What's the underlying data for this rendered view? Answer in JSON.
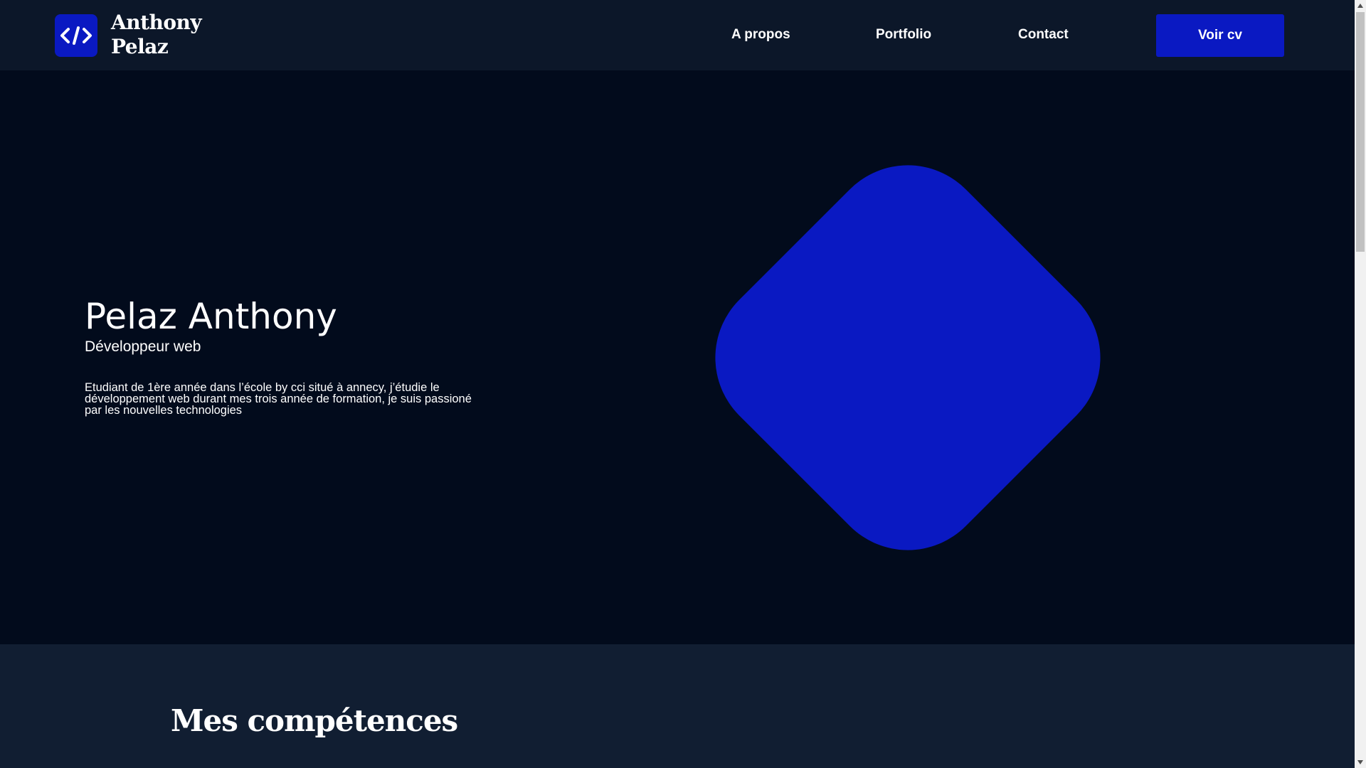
{
  "header": {
    "logo_icon": "code-brackets-icon",
    "logo_line1": "Anthony",
    "logo_line2": "Pelaz",
    "nav": {
      "about": "A propos",
      "portfolio": "Portfolio",
      "contact": "Contact"
    },
    "cv_button": "Voir cv"
  },
  "hero": {
    "name": "Pelaz Anthony",
    "role": "Développeur web",
    "description": "Etudiant de 1ère année dans l’école by cci situé à annecy, j’étudie le développement web durant mes trois année de formation, je suis passioné par les nouvelles technologies"
  },
  "skills": {
    "title": "Mes compétences"
  },
  "colors": {
    "accent": "#0a19c2",
    "header_bg": "#0c1729",
    "hero_bg": "#020b1c",
    "section_bg": "#111e32"
  }
}
